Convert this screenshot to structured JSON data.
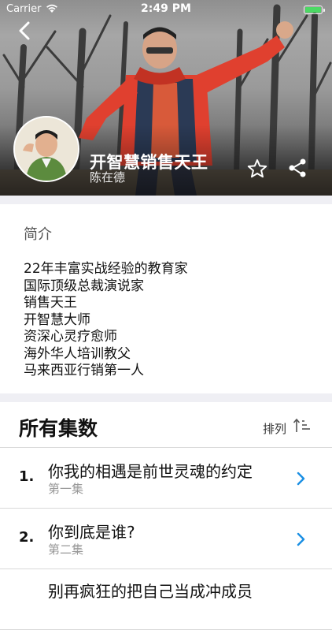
{
  "status_bar": {
    "carrier": "Carrier",
    "time": "2:49 PM"
  },
  "header": {
    "title": "开智慧销售天王",
    "subtitle": "陈在德",
    "icons": [
      "back-icon",
      "star-icon",
      "share-icon"
    ]
  },
  "intro": {
    "heading": "简介",
    "lines": [
      "22年丰富实战经验的教育家",
      "国际顶级总裁演说家",
      "销售天王",
      "开智慧大师",
      "资深心灵疗愈师",
      "海外华人培训教父",
      "马来西亚行销第一人"
    ]
  },
  "episodes": {
    "heading": "所有集数",
    "sort_label": "排列",
    "items": [
      {
        "number": "1.",
        "title": "你我的相遇是前世灵魂的约定",
        "subtitle": "第一集"
      },
      {
        "number": "2.",
        "title": "你到底是谁?",
        "subtitle": "第二集"
      },
      {
        "number": "",
        "title": "别再疯狂的把自己当成冲成员",
        "subtitle": ""
      }
    ]
  },
  "colors": {
    "accent_blue": "#1a8fe3",
    "battery_green": "#4cd964",
    "section_gap": "#efeff4",
    "jacket_red": "#e0402f"
  }
}
